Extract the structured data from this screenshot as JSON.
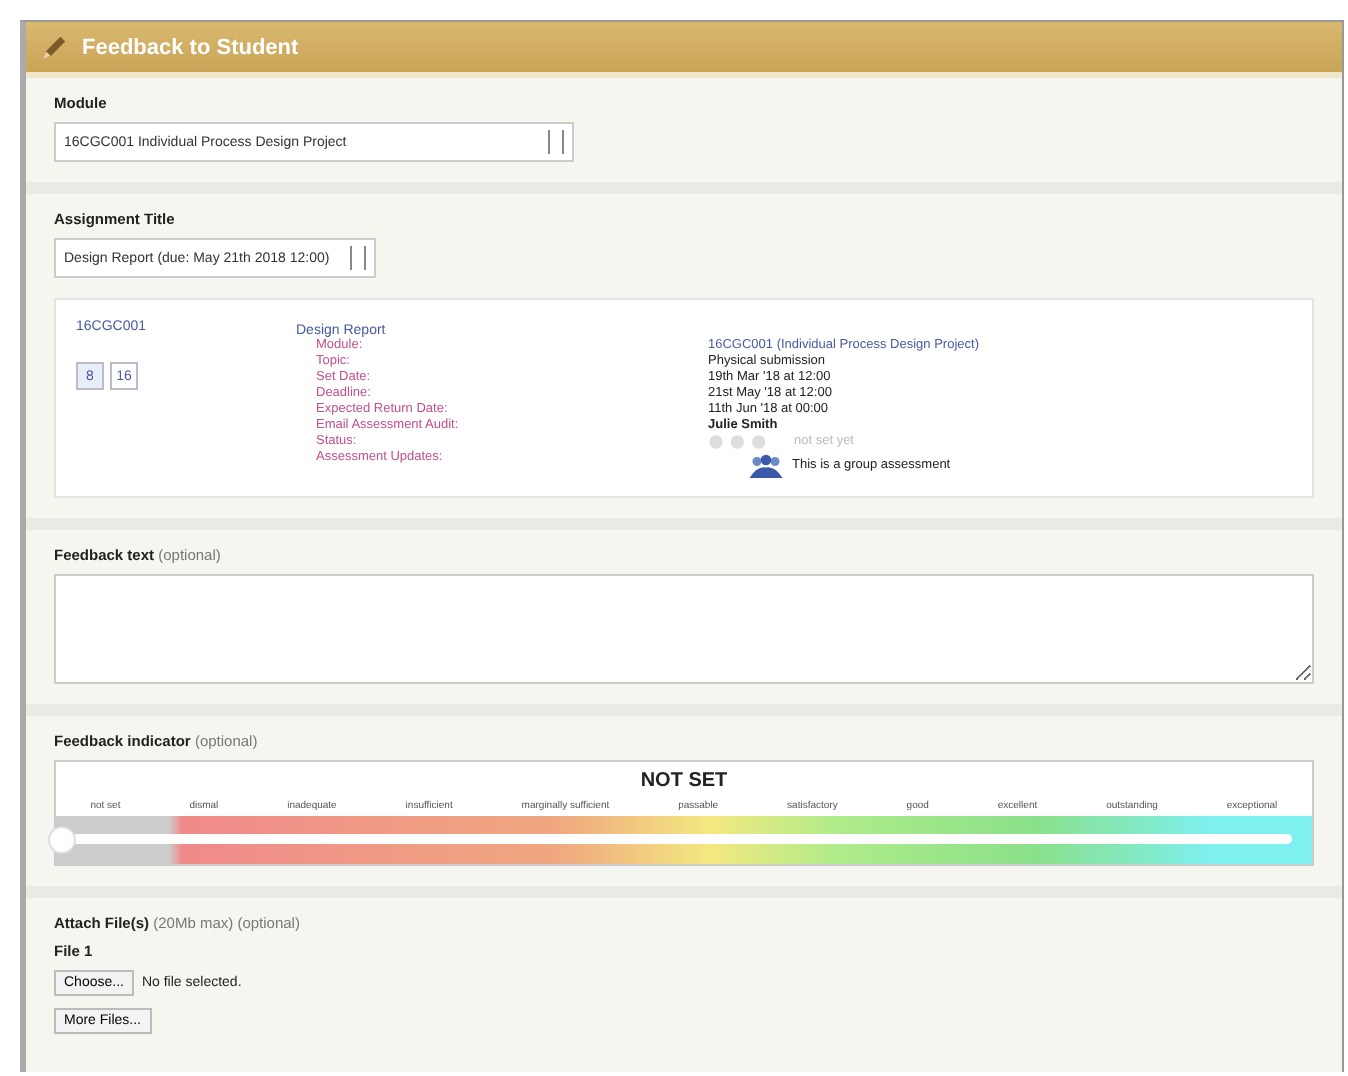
{
  "window": {
    "title": "Feedback to Student"
  },
  "module": {
    "label": "Module",
    "value": "16CGC001 Individual Process Design Project"
  },
  "assignment": {
    "label": "Assignment Title",
    "value": "Design Report (due: May 21th 2018 12:00)"
  },
  "summary": {
    "code": "16CGC001",
    "pages": [
      {
        "label": "8",
        "selected": true
      },
      {
        "label": "16",
        "selected": false
      }
    ],
    "title": "Design Report",
    "fields": [
      {
        "label": "Module:",
        "value": "16CGC001 (Individual Process Design Project)",
        "kind": "link"
      },
      {
        "label": "Topic:",
        "value": "Physical submission",
        "kind": "text"
      },
      {
        "label": "Set Date:",
        "value": "19th Mar '18 at 12:00",
        "kind": "text"
      },
      {
        "label": "Deadline:",
        "value": "21st May '18 at 12:00",
        "kind": "text"
      },
      {
        "label": "Expected Return Date:",
        "value": "11th Jun '18 at 00:00",
        "kind": "text"
      },
      {
        "label": "Email Assessment Audit:",
        "value": "Julie Smith",
        "kind": "bold"
      },
      {
        "label": "Status:",
        "value": "not set yet",
        "kind": "muted"
      },
      {
        "label": "Assessment Updates:",
        "value": "This is a group assessment",
        "kind": "group"
      }
    ]
  },
  "feedback_text": {
    "label": "Feedback text",
    "hint": "(optional)"
  },
  "indicator": {
    "label": "Feedback indicator",
    "hint": "(optional)",
    "reading": "NOT SET",
    "level": 0,
    "scale": [
      "not set",
      "dismal",
      "inadequate",
      "insufficient",
      "marginally sufficient",
      "passable",
      "satisfactory",
      "good",
      "excellent",
      "outstanding",
      "exceptional"
    ]
  },
  "attach": {
    "label": "Attach File(s)",
    "hint": "(20Mb max) (optional)",
    "file_label": "File 1",
    "choose": "Choose...",
    "status": "No file selected.",
    "more": "More Files..."
  }
}
